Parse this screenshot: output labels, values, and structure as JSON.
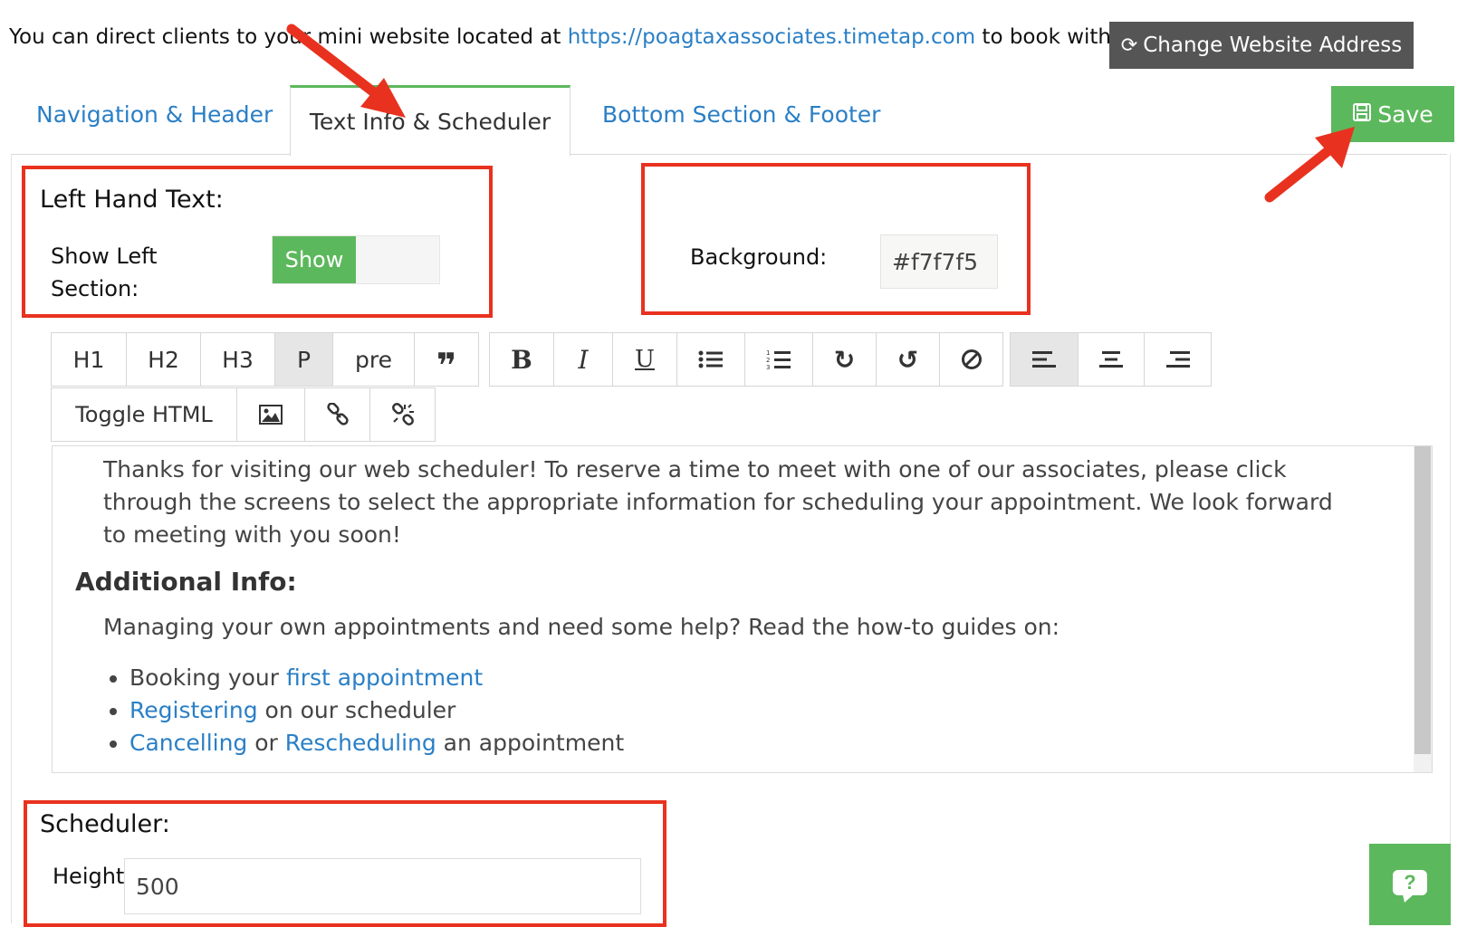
{
  "intro": {
    "prefix": "You can direct clients to your mini website located at ",
    "url": "https://poagtaxassociates.timetap.com",
    "suffix": " to book with you.",
    "change_button": "Change Website Address"
  },
  "tabs": [
    {
      "label": "Navigation & Header",
      "active": false
    },
    {
      "label": "Text Info & Scheduler",
      "active": true
    },
    {
      "label": "Bottom Section & Footer",
      "active": false
    }
  ],
  "save_button": "Save",
  "left_text": {
    "title": "Left Hand Text:",
    "show_label": "Show Left Section:",
    "toggle_value": "Show"
  },
  "background": {
    "label": "Background:",
    "value": "#f7f7f5"
  },
  "toolbar": {
    "h1": "H1",
    "h2": "H2",
    "h3": "H3",
    "p": "P",
    "pre": "pre",
    "bold": "B",
    "italic": "I",
    "underline": "U",
    "toggle_html": "Toggle HTML"
  },
  "editor": {
    "intro_paragraph": "Thanks for visiting our web scheduler! To reserve a time to meet with one of our associates, please click through the screens to select the appropriate information for scheduling your appointment. We look forward to meeting with you soon!",
    "heading": "Additional Info:",
    "help_line": "Managing your own appointments and need some help? Read the how-to guides on:",
    "items": [
      {
        "before": "Booking your ",
        "link1": "first appointment",
        "middle": "",
        "link2": "",
        "after": ""
      },
      {
        "before": "",
        "link1": "Registering",
        "middle": " on our scheduler",
        "link2": "",
        "after": ""
      },
      {
        "before": "",
        "link1": "Cancelling",
        "middle": " or ",
        "link2": "Rescheduling",
        "after": " an appointment"
      }
    ]
  },
  "scheduler": {
    "title": "Scheduler:",
    "height_label": "Height",
    "height_value": "500"
  },
  "help_icon_text": "?",
  "colors": {
    "accent_green": "#5cb85c",
    "link_blue": "#2a7fc6",
    "annotation_red": "#e8321f",
    "dark_button": "#555555"
  }
}
